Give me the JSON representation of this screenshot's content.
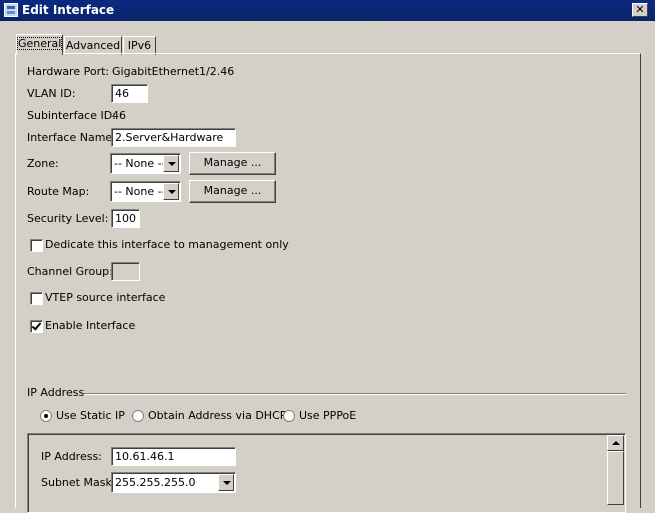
{
  "window": {
    "title": "Edit Interface",
    "close_glyph": "✕"
  },
  "tabs": [
    {
      "label": "General",
      "active": true
    },
    {
      "label": "Advanced",
      "active": false
    },
    {
      "label": "IPv6",
      "active": false
    }
  ],
  "general": {
    "hardware_port_label": "Hardware Port:",
    "hardware_port_value": "GigabitEthernet1/2.46",
    "vlan_id_label": "VLAN ID:",
    "vlan_id_value": "46",
    "subinterface_id_label": "Subinterface ID:",
    "subinterface_id_value": "46",
    "interface_name_label": "Interface Name:",
    "interface_name_value": "2.Server&Hardware",
    "zone_label": "Zone:",
    "zone_value": "-- None --",
    "route_map_label": "Route Map:",
    "route_map_value": "-- None --",
    "manage_label": "Manage ...",
    "security_level_label": "Security Level:",
    "security_level_value": "100",
    "dedicate_mgmt_label": "Dedicate this interface to management only",
    "dedicate_mgmt_checked": false,
    "channel_group_label": "Channel Group:",
    "channel_group_value": "",
    "vtep_label": "VTEP source interface",
    "vtep_checked": false,
    "enable_interface_label": "Enable Interface",
    "enable_interface_checked": true
  },
  "ip_address": {
    "group_label": "IP Address",
    "options": [
      {
        "label": "Use Static IP",
        "selected": true
      },
      {
        "label": "Obtain Address via DHCP",
        "selected": false
      },
      {
        "label": "Use PPPoE",
        "selected": false
      }
    ],
    "ip_label": "IP Address:",
    "ip_value": "10.61.46.1",
    "subnet_label": "Subnet Mask:",
    "subnet_value": "255.255.255.0"
  },
  "colors": {
    "titlebar": "#0a246a",
    "dialog_bg": "#d4d0c8"
  }
}
